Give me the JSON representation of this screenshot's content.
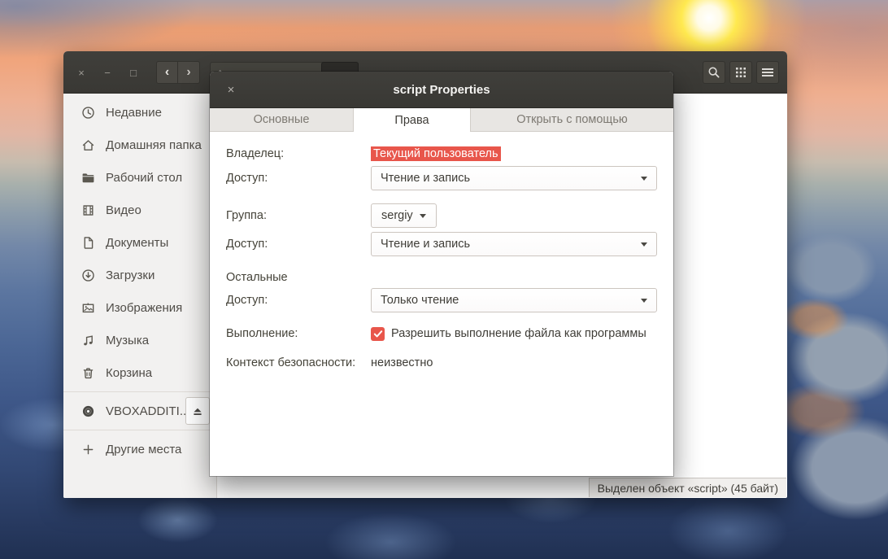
{
  "colors": {
    "accent_red": "#e8564b",
    "titlebar_dark": "#3a3936",
    "sidebar_bg": "#f2f1f0",
    "tab_strip_bg": "#e8e6e3",
    "content_bg": "#ffffff"
  },
  "file_manager": {
    "window_controls": {
      "close": "×",
      "minimize": "−",
      "maximize": "□"
    },
    "nav": {
      "back": "‹",
      "forward": "›"
    },
    "header_icons": [
      "search-icon",
      "grid-view-icon",
      "hamburger-menu-icon"
    ],
    "sidebar": {
      "items": [
        {
          "icon": "clock-icon",
          "label": "Недавние"
        },
        {
          "icon": "home-icon",
          "label": "Домашняя папка"
        },
        {
          "icon": "folder-icon",
          "label": "Рабочий стол"
        },
        {
          "icon": "film-icon",
          "label": "Видео"
        },
        {
          "icon": "document-icon",
          "label": "Документы"
        },
        {
          "icon": "download-icon",
          "label": "Загрузки"
        },
        {
          "icon": "image-icon",
          "label": "Изображения"
        },
        {
          "icon": "music-icon",
          "label": "Музыка"
        },
        {
          "icon": "trash-icon",
          "label": "Корзина"
        },
        {
          "icon": "disc-icon",
          "label": "VBOXADDITI..."
        },
        {
          "icon": "plus-icon",
          "label": "Другие места"
        }
      ]
    },
    "statusbar": {
      "text": "Выделен объект «script» (45 байт)"
    }
  },
  "dialog": {
    "title": "script Properties",
    "close": "×",
    "tabs": [
      {
        "label": "Основные",
        "active": false
      },
      {
        "label": "Права",
        "active": true
      },
      {
        "label": "Открыть с помощью",
        "active": false
      }
    ],
    "permissions": {
      "owner_label": "Владелец:",
      "owner_value": "Текущий пользователь",
      "owner_access_label": "Доступ:",
      "owner_access_value": "Чтение и запись",
      "group_label": "Группа:",
      "group_value": "sergiy",
      "group_access_label": "Доступ:",
      "group_access_value": "Чтение и запись",
      "others_label": "Остальные",
      "others_access_label": "Доступ:",
      "others_access_value": "Только чтение",
      "execute_label": "Выполнение:",
      "execute_checkbox_label": "Разрешить выполнение файла как программы",
      "execute_checked": true,
      "security_label": "Контекст безопасности:",
      "security_value": "неизвестно"
    }
  }
}
